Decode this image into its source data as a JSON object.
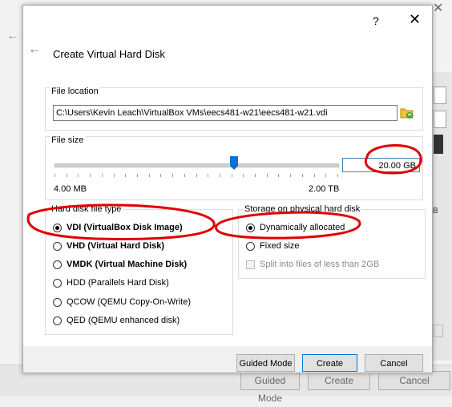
{
  "background": {
    "bottom_buttons": [
      "Guided Mode",
      "Create",
      "Cancel"
    ],
    "right_label": "B"
  },
  "titlebar": {
    "help": "?",
    "close": "✕"
  },
  "dialog": {
    "title": "Create Virtual Hard Disk",
    "file_location": {
      "label": "File location",
      "path": "C:\\Users\\Kevin Leach\\VirtualBox VMs\\eecs481-w21\\eecs481-w21.vdi"
    },
    "file_size": {
      "label": "File size",
      "min_label": "4.00 MB",
      "max_label": "2.00 TB",
      "value": "20.00 GB"
    },
    "disk_type": {
      "label": "Hard disk file type",
      "options": [
        "VDI (VirtualBox Disk Image)",
        "VHD (Virtual Hard Disk)",
        "VMDK (Virtual Machine Disk)",
        "HDD (Parallels Hard Disk)",
        "QCOW (QEMU Copy-On-Write)",
        "QED (QEMU enhanced disk)"
      ],
      "selected": 0
    },
    "storage": {
      "label": "Storage on physical hard disk",
      "options": [
        "Dynamically allocated",
        "Fixed size"
      ],
      "selected": 0,
      "split_label": "Split into files of less than 2GB"
    },
    "buttons": {
      "guided": "Guided Mode",
      "create": "Create",
      "cancel": "Cancel"
    }
  },
  "colors": {
    "annotation": "#e00000",
    "focus_border": "#0078d7"
  }
}
